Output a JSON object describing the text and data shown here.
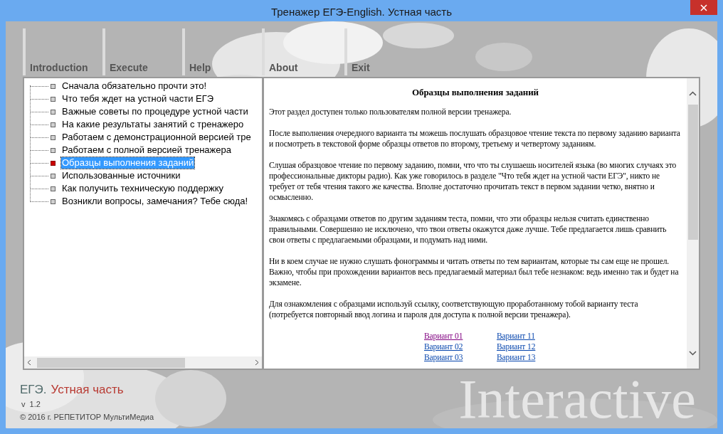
{
  "window": {
    "title": "Тренажер ЕГЭ-English. Устная часть"
  },
  "menu": [
    {
      "label": "Introduction"
    },
    {
      "label": "Execute"
    },
    {
      "label": "Help"
    },
    {
      "label": "About"
    },
    {
      "label": "Exit"
    }
  ],
  "tree": {
    "items": [
      {
        "label": "Сначала обязательно прочти это!",
        "selected": false
      },
      {
        "label": "Что тебя ждет на устной части ЕГЭ",
        "selected": false
      },
      {
        "label": "Важные советы по процедуре устной части",
        "selected": false
      },
      {
        "label": "На какие результаты занятий с тренажеро",
        "selected": false
      },
      {
        "label": "Работаем с демонстрационной версией тре",
        "selected": false
      },
      {
        "label": "Работаем с полной версией тренажера",
        "selected": false
      },
      {
        "label": "Образцы выполнения заданий",
        "selected": true
      },
      {
        "label": "Использованные источники",
        "selected": false
      },
      {
        "label": "Как получить техническую поддержку",
        "selected": false
      },
      {
        "label": "Возникли вопросы, замечания? Тебе сюда!",
        "selected": false
      }
    ]
  },
  "document": {
    "heading": "Образцы выполнения заданий",
    "paragraphs": [
      "Этот раздел доступен только пользователям полной версии тренажера.",
      "После выполнения очередного варианта ты можешь послушать образцовое чтение текста по первому заданию варианта и посмотреть в текстовой форме образцы ответов по второму, третьему и четвертому заданиям.",
      "Слушая образцовое чтение по первому заданию, помни, что что ты слушаешь носителей языка (во многих случаях это профессиональные дикторы радио). Как уже говорилось в разделе \"Что тебя ждет на устной части ЕГЭ\", никто не требует от тебя чтения такого же качества. Вполне достаточно прочитать текст в первом задании четко, внятно и осмысленно.",
      "Знакомясь с образцами ответов по другим заданиям теста, помни, что эти образцы нельзя считать единственно правильными. Совершенно не исключено, что твои ответы окажутся даже лучше. Тебе предлагается лишь сравнить свои ответы с предлагаемыми образцами, и подумать над ними.",
      "Ни в коем случае не нужно слушать фонограммы и читать ответы по тем вариантам, которые ты сам еще не прошел. Важно, чтобы при прохождении вариантов весь предлагаемый материал был тебе незнаком: ведь именно так и будет на экзамене.",
      "Для ознакомления с образцами используй ссылку, соответствующую проработанному тобой варианту теста (потребуется повторный ввод логина и пароля для доступа к полной версии тренажера)."
    ],
    "links": [
      {
        "label": "Вариант 01",
        "visited": true
      },
      {
        "label": "Вариант 11",
        "visited": false
      },
      {
        "label": "Вариант 02",
        "visited": false
      },
      {
        "label": "Вариант 12",
        "visited": false
      },
      {
        "label": "Вариант 03",
        "visited": false
      },
      {
        "label": "Вариант 13",
        "visited": false
      }
    ]
  },
  "footer": {
    "brand": "ЕГЭ.",
    "subtitle": "Устная часть",
    "version": "v  1.2",
    "copyright": "© 2016 г. РЕПЕТИТОР МультиМедиа",
    "watermark_text": "Interactive"
  }
}
